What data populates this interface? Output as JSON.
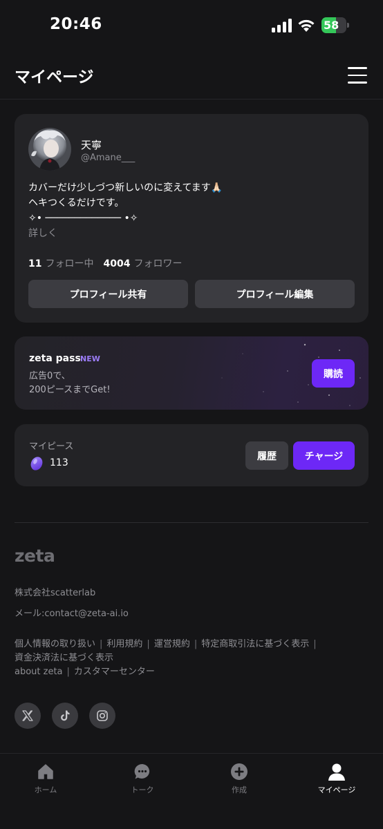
{
  "status": {
    "time": "20:46",
    "battery": "58",
    "battery_level": 58,
    "battery_color": "#34c759"
  },
  "header": {
    "title": "マイページ",
    "menu_icon": "hamburger-icon"
  },
  "profile": {
    "name": "天寧",
    "handle": "@Amane___",
    "bio_lines": [
      "カバーだけ少しづつ新しいのに変えてます🙏🏻",
      "ヘキつくるだけです。",
      "✧• ───────────── •✧"
    ],
    "more_label": "詳しく",
    "following_count": "11",
    "following_label": "フォロー中",
    "followers_count": "4004",
    "followers_label": "フォロワー",
    "share_label": "プロフィール共有",
    "edit_label": "プロフィール編集"
  },
  "zeta_pass": {
    "title": "zeta pass",
    "badge": "NEW",
    "desc_line1": "広告0で、",
    "desc_line2": "200ピースまでGet!",
    "subscribe_label": "購読"
  },
  "my_piece": {
    "label": "マイピース",
    "count": "113",
    "history_label": "履歴",
    "charge_label": "チャージ"
  },
  "footer": {
    "logo": "zeta",
    "company": "株式会社scatterlab",
    "mail": "メール:contact@zeta-ai.io",
    "links": {
      "privacy": "個人情報の取り扱い",
      "terms": "利用規約",
      "operation": "運営規約",
      "commerce": "特定商取引法に基づく表示",
      "payment": "資金決済法に基づく表示",
      "about": "about zeta",
      "support": "カスタマーセンター"
    },
    "socials": [
      "x-icon",
      "tiktok-icon",
      "instagram-icon"
    ]
  },
  "tabs": [
    {
      "label": "ホーム",
      "icon": "home-icon",
      "active": false
    },
    {
      "label": "トーク",
      "icon": "chat-bubble-icon",
      "active": false
    },
    {
      "label": "作成",
      "icon": "plus-circle-icon",
      "active": false
    },
    {
      "label": "マイページ",
      "icon": "person-icon",
      "active": true
    }
  ],
  "colors": {
    "accent": "#6d28f6",
    "background": "#151517",
    "card": "#232326",
    "badge": "#9b7cf6"
  }
}
